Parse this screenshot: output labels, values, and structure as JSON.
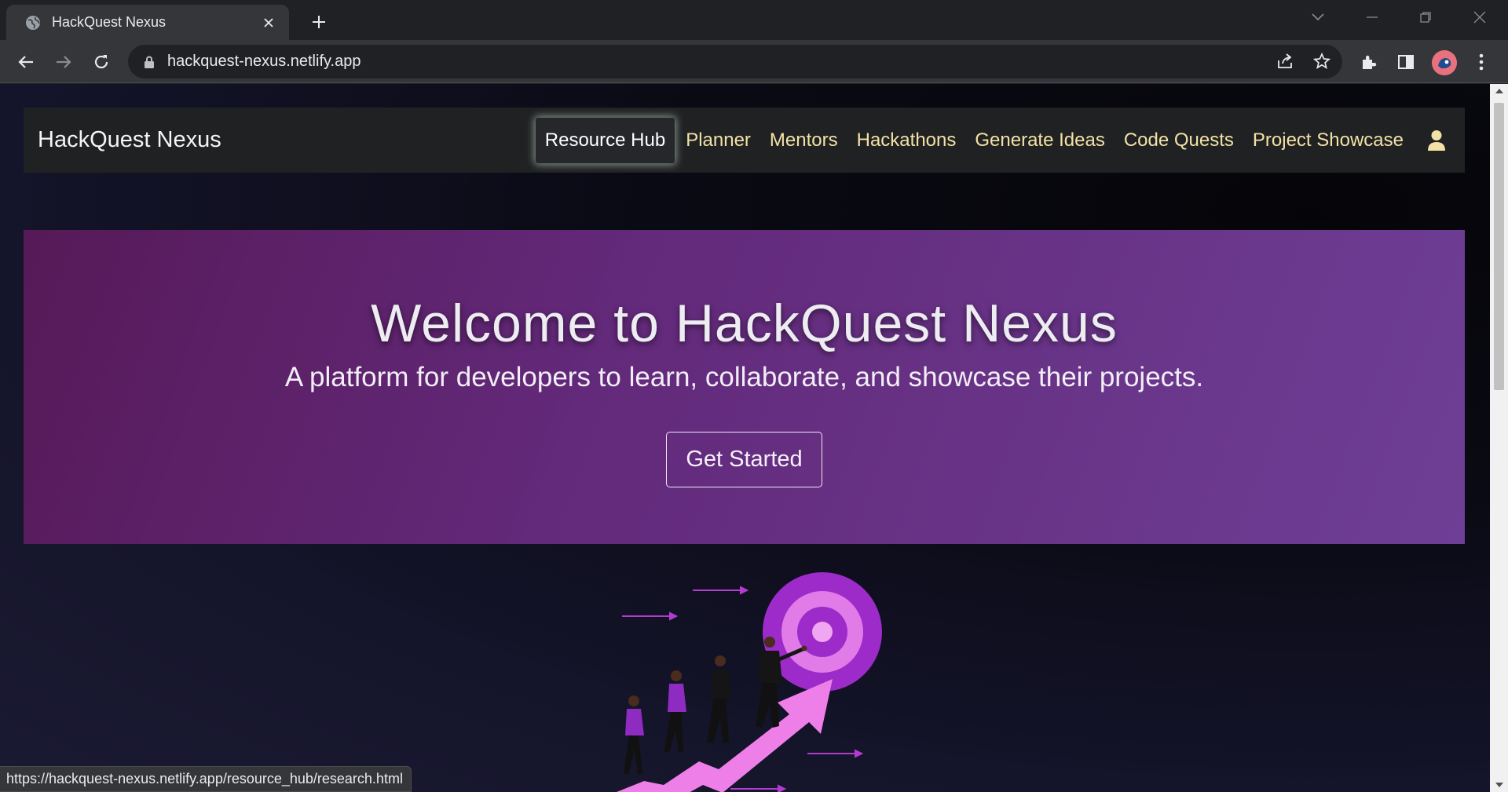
{
  "browser": {
    "tab_title": "HackQuest Nexus",
    "url": "hackquest-nexus.netlify.app",
    "status_url": "https://hackquest-nexus.netlify.app/resource_hub/research.html"
  },
  "navbar": {
    "brand": "HackQuest Nexus",
    "links": [
      "Resource Hub",
      "Planner",
      "Mentors",
      "Hackathons",
      "Generate Ideas",
      "Code Quests",
      "Project Showcase"
    ],
    "active": "Resource Hub",
    "link_color": "#f3e2a6"
  },
  "hero": {
    "title": "Welcome to HackQuest Nexus",
    "subtitle": "A platform for developers to learn, collaborate, and showcase their projects.",
    "button": "Get Started",
    "gradient_from": "#561a58",
    "gradient_to": "#6e3f96"
  },
  "icons": {
    "favicon": "globe-icon",
    "user": "user-icon"
  }
}
